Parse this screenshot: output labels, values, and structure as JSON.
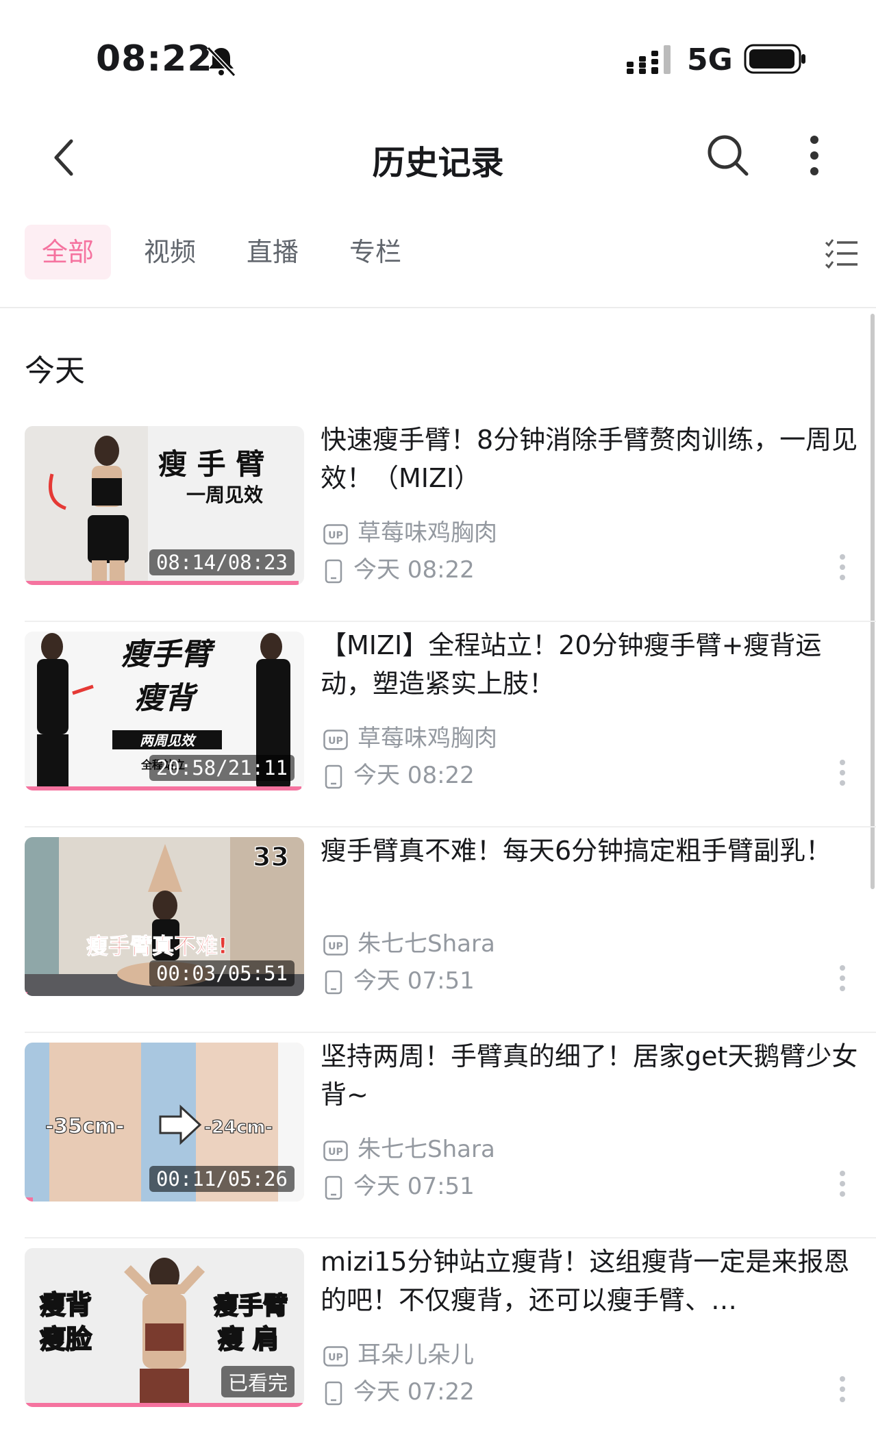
{
  "status": {
    "time": "08:22",
    "network": "5G"
  },
  "header": {
    "title": "历史记录"
  },
  "tabs": [
    {
      "label": "全部",
      "active": true
    },
    {
      "label": "视频",
      "active": false
    },
    {
      "label": "直播",
      "active": false
    },
    {
      "label": "专栏",
      "active": false
    }
  ],
  "section_label": "今天",
  "items": [
    {
      "title": "快速瘦手臂！8分钟消除手臂赘肉训练，一周见效！（MIZI）",
      "uploader": "草莓味鸡胸肉",
      "time": "今天 08:22",
      "duration": "08:14/08:23",
      "progress": 0.98,
      "thumb_text": [
        "瘦 手 臂",
        "一周见效"
      ]
    },
    {
      "title": "【MIZI】全程站立！20分钟瘦手臂+瘦背运动，塑造紧实上肢！",
      "uploader": "草莓味鸡胸肉",
      "time": "今天 08:22",
      "duration": "20:58/21:11",
      "progress": 0.99,
      "thumb_text": [
        "瘦手臂",
        "瘦背",
        "两周见效",
        "全程站立"
      ]
    },
    {
      "title": "瘦手臂真不难！每天6分钟搞定粗手臂副乳！",
      "uploader": "朱七七Shara",
      "time": "今天 07:51",
      "duration": "00:03/05:51",
      "progress": 0.01,
      "thumb_text": [
        "33",
        "瘦手臂真不难!"
      ]
    },
    {
      "title": "坚持两周！手臂真的细了！居家get天鹅臂少女背~",
      "uploader": "朱七七Shara",
      "time": "今天 07:51",
      "duration": "00:11/05:26",
      "progress": 0.03,
      "thumb_text": [
        "-35cm-",
        "-24cm-"
      ]
    },
    {
      "title": "mizi15分钟站立瘦背！这组瘦背一定是来报恩的吧！不仅瘦背，还可以瘦手臂、…",
      "uploader": "耳朵儿朵儿",
      "time": "今天 07:22",
      "duration": "已看完",
      "progress": 1.0,
      "thumb_text": [
        "瘦背",
        "瘦脸",
        "瘦手臂",
        "瘦 肩"
      ]
    }
  ],
  "colors": {
    "accent": "#f5739f",
    "tab_bg": "#fdeef3",
    "meta": "#9499a0"
  },
  "icons": [
    "back-arrow-icon",
    "search-icon",
    "more-vertical-icon",
    "list-manage-icon",
    "up-badge-icon",
    "device-phone-icon",
    "bell-mute-icon"
  ]
}
